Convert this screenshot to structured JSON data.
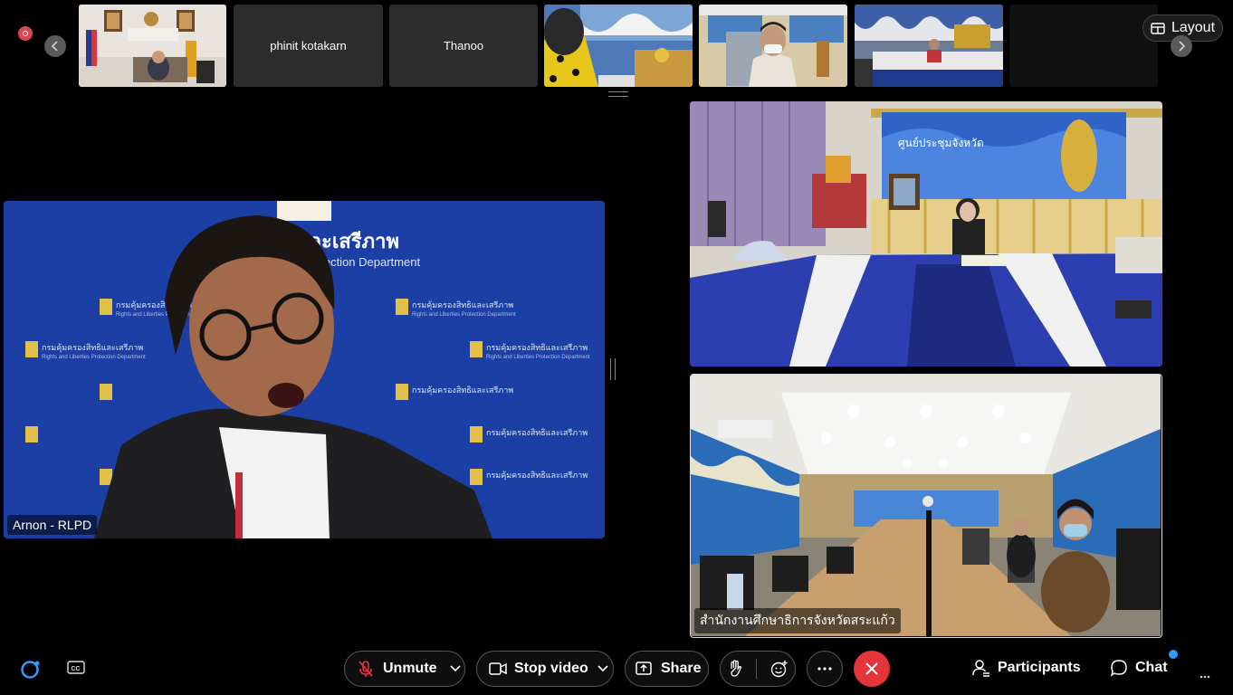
{
  "thumbnails": [
    {
      "id": "t1",
      "label": ""
    },
    {
      "id": "t2",
      "label": "phinit kotakarn"
    },
    {
      "id": "t3",
      "label": "Thanoo"
    },
    {
      "id": "t4",
      "label": ""
    },
    {
      "id": "t5",
      "label": ""
    },
    {
      "id": "t6",
      "label": ""
    },
    {
      "id": "t7",
      "label": ""
    }
  ],
  "header": {
    "layout_label": "Layout"
  },
  "main_video": {
    "participant_name": "Arnon - RLPD",
    "backdrop_title": "สิทธิและเสรีภาพ",
    "backdrop_subtitle": "Protection Department",
    "backdrop_logo_text": "กรมคุ้มครองสิทธิและเสรีภาพ",
    "backdrop_logo_sub": "Rights and Liberties Protection Department"
  },
  "right_videos": [
    {
      "name": "",
      "banner_text": "ศูนย์ประชุมจังหวัด"
    },
    {
      "name": "สำนักงานศึกษาธิการจังหวัดสระแก้ว"
    }
  ],
  "toolbar": {
    "unmute_label": "Unmute",
    "stop_video_label": "Stop video",
    "share_label": "Share",
    "participants_label": "Participants",
    "chat_label": "Chat"
  },
  "colors": {
    "accent": "#2f9cff",
    "end_call": "#e5343a",
    "record": "#e0454f"
  }
}
